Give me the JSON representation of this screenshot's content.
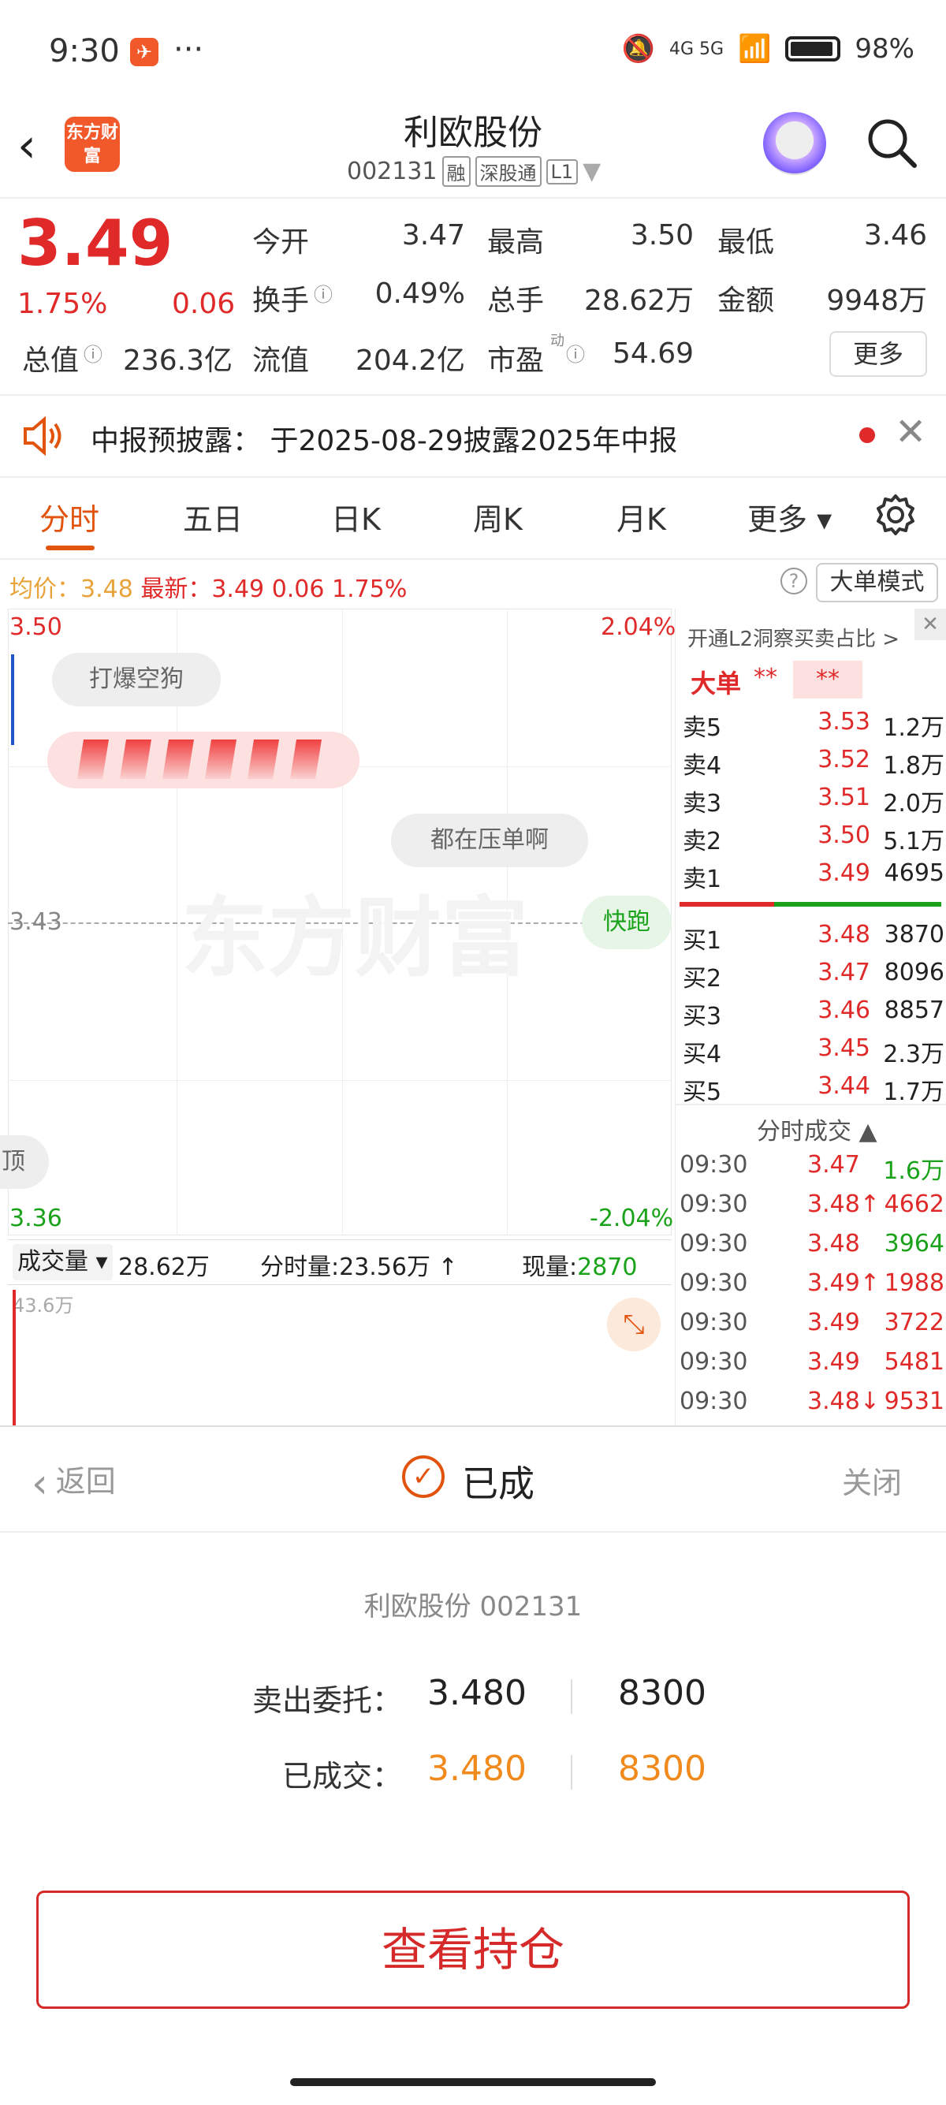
{
  "status_bar": {
    "time": "9:30",
    "dots": "···",
    "signal": "4G 5G",
    "battery": "98%"
  },
  "header": {
    "logo": "东方财富",
    "stock_name": "利欧股份",
    "stock_code": "002131",
    "tags": [
      "融",
      "深股通",
      "L1"
    ]
  },
  "quote": {
    "price": "3.49",
    "pct": "1.75%",
    "change": "0.06",
    "fields": [
      {
        "label": "今开",
        "value": "3.47"
      },
      {
        "label": "最高",
        "value": "3.50"
      },
      {
        "label": "最低",
        "value": "3.46"
      },
      {
        "label": "换手",
        "value": "0.49%"
      },
      {
        "label": "总手",
        "value": "28.62万"
      },
      {
        "label": "金额",
        "value": "9948万"
      },
      {
        "label": "总值",
        "value": "236.3亿"
      },
      {
        "label": "流值",
        "value": "204.2亿"
      },
      {
        "label": "市盈",
        "value": "54.69"
      }
    ],
    "pe_sup": "动",
    "more": "更多"
  },
  "notice": {
    "text": "中报预披露： 于2025-08-29披露2025年中报",
    "close": "✕"
  },
  "tabs": [
    "分时",
    "五日",
    "日K",
    "周K",
    "月K",
    "更多 ▾"
  ],
  "avg_line": {
    "avg_label": "均价：",
    "avg": "3.48",
    "latest_label": "最新：",
    "latest": "3.49",
    "chg": "0.06",
    "pct": "1.75%"
  },
  "help": "?",
  "big_mode": "大单模式",
  "chart": {
    "y_top": "3.50",
    "y_top_pct": "2.04%",
    "y_mid": "3.43",
    "y_bot": "3.36",
    "y_bot_pct": "-2.04%",
    "bubble1": "打爆空狗",
    "bubble2": "都在压单啊",
    "bubble3": "快跑",
    "bubble4": "顶",
    "watermark": "东方财富"
  },
  "volume": {
    "selector": "成交量 ▾",
    "total": "28.62万",
    "minute_label": "分时量:",
    "minute": "23.56万 ↑",
    "now_label": "现量:",
    "now": "2870",
    "max": "43.6万"
  },
  "l2": {
    "title": "开通L2洞察买卖占比 >",
    "big_label": "大单",
    "big_val1": "**",
    "big_val2": "**"
  },
  "sells": [
    {
      "label": "卖5",
      "price": "3.53",
      "vol": "1.2万"
    },
    {
      "label": "卖4",
      "price": "3.52",
      "vol": "1.8万"
    },
    {
      "label": "卖3",
      "price": "3.51",
      "vol": "2.0万"
    },
    {
      "label": "卖2",
      "price": "3.50",
      "vol": "5.1万"
    },
    {
      "label": "卖1",
      "price": "3.49",
      "vol": "4695"
    }
  ],
  "buys": [
    {
      "label": "买1",
      "price": "3.48",
      "vol": "3870"
    },
    {
      "label": "买2",
      "price": "3.47",
      "vol": "8096"
    },
    {
      "label": "买3",
      "price": "3.46",
      "vol": "8857"
    },
    {
      "label": "买4",
      "price": "3.45",
      "vol": "2.3万"
    },
    {
      "label": "买5",
      "price": "3.44",
      "vol": "1.7万"
    }
  ],
  "ticks_title": "分时成交 ▲",
  "ticks": [
    {
      "time": "09:30",
      "price": "3.47",
      "vol": "1.6万",
      "side": "buy"
    },
    {
      "time": "09:30",
      "price": "3.48↑",
      "vol": "4662",
      "side": "sell"
    },
    {
      "time": "09:30",
      "price": "3.48",
      "vol": "3964",
      "side": "buy"
    },
    {
      "time": "09:30",
      "price": "3.49↑",
      "vol": "1988",
      "side": "sell"
    },
    {
      "time": "09:30",
      "price": "3.49",
      "vol": "3722",
      "side": "sell"
    },
    {
      "time": "09:30",
      "price": "3.49",
      "vol": "5481",
      "side": "sell"
    },
    {
      "time": "09:30",
      "price": "3.48↓",
      "vol": "9531",
      "side": "buy"
    }
  ],
  "sheet": {
    "back": "返回",
    "title": "已成",
    "close": "关闭",
    "check": "✓",
    "stock": "利欧股份 002131",
    "order_label": "卖出委托：",
    "order_price": "3.480",
    "order_qty": "8300",
    "filled_label": "已成交：",
    "filled_price": "3.480",
    "filled_qty": "8300",
    "view_button": "查看持仓"
  }
}
